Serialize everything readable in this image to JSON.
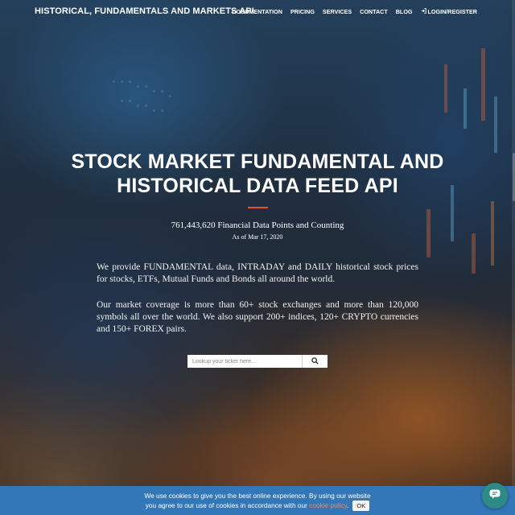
{
  "nav": {
    "brand": "HISTORICAL, FUNDAMENTALS AND MARKETS API",
    "links": {
      "documentation": "DOCUMENTATION",
      "pricing": "PRICING",
      "services": "SERVICES",
      "contact": "CONTACT",
      "blog": "BLOG",
      "login": "LOGIN/REGISTER"
    },
    "login_icon": "sign-in-icon"
  },
  "hero": {
    "title_line1": "STOCK MARKET FUNDAMENTAL AND",
    "title_line2": "HISTORICAL DATA FEED API",
    "accent_color": "#e2572e",
    "stats_text": "761,443,620 Financial Data Points and Counting",
    "stats_date": "As of Mar 17, 2020",
    "paragraph1": "We provide FUNDAMENTAL data, INTRADAY and DAILY historical stock prices for stocks, ETFs, Mutual Funds and Bonds all around the world.",
    "paragraph2": "Our market coverage is more than 60+ stock exchanges and more than 120,000 symbols all over the world. We also support 200+ indices, 120+ CRYPTO currencies and 150+ FOREX pairs."
  },
  "search": {
    "placeholder": "Lookup your ticker here...",
    "value": "",
    "button_icon": "search-icon"
  },
  "cookie": {
    "text_line1": "We use cookies to give you the best online experience. By using our website",
    "text_line2_before": "you agree to our use of cookies in accordance with our ",
    "link_text": "cookie policy",
    "text_line2_after": ".",
    "ok_label": "OK",
    "bar_color": "#3377b8"
  },
  "chat": {
    "icon": "chat-icon",
    "color": "#2d8a87"
  }
}
